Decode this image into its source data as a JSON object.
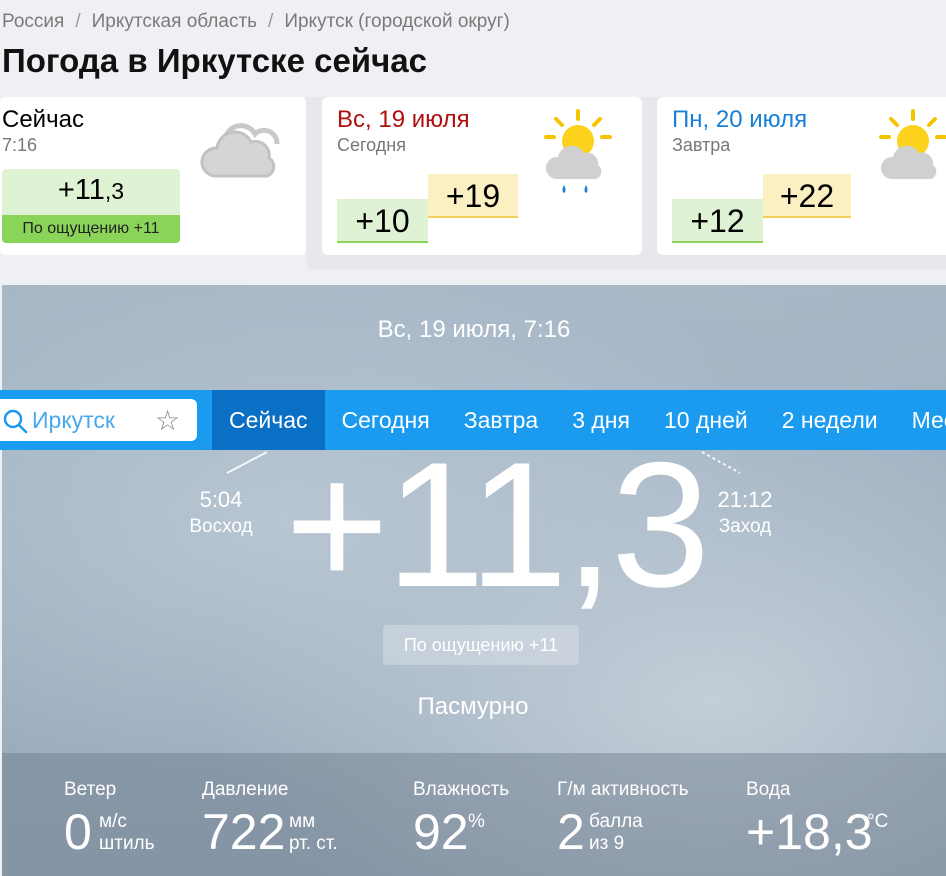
{
  "breadcrumb": [
    "Россия",
    "Иркутская область",
    "Иркутск (городской округ)"
  ],
  "page_title": "Погода в Иркутске сейчас",
  "now_card": {
    "title": "Сейчас",
    "time": "7:16",
    "temp_main": "+11",
    "temp_frac": ",3",
    "feels": "По ощущению +11",
    "icon": "cloudy-icon"
  },
  "today_card": {
    "title": "Вс, 19 июля",
    "sub": "Сегодня",
    "low": "+10",
    "high": "+19",
    "icon": "partly-cloudy-rain-icon"
  },
  "tomorrow_card": {
    "title": "Пн, 20 июля",
    "sub": "Завтра",
    "low": "+12",
    "high": "+22",
    "icon": "partly-cloudy-icon"
  },
  "hero": {
    "datetime": "Вс, 19 июля, 7:16",
    "temp": "+11,3",
    "feels": "По ощущению +11",
    "condition": "Пасмурно",
    "sunrise_time": "5:04",
    "sunrise_label": "Восход",
    "sunset_time": "21:12",
    "sunset_label": "Заход"
  },
  "search": {
    "value": "",
    "placeholder": "Иркутск"
  },
  "tabs": [
    "Сейчас",
    "Сегодня",
    "Завтра",
    "3 дня",
    "10 дней",
    "2 недели",
    "Месяц"
  ],
  "stats": {
    "wind": {
      "label": "Ветер",
      "value": "0",
      "unit": "м/с",
      "desc": "штиль"
    },
    "pressure": {
      "label": "Давление",
      "value": "722",
      "unit": "мм",
      "desc": "рт. ст."
    },
    "humidity": {
      "label": "Влажность",
      "value": "92",
      "unit": "%"
    },
    "geomagnetic": {
      "label": "Г/м активность",
      "value": "2",
      "unit": "балла",
      "desc": "из 9"
    },
    "water": {
      "label": "Вода",
      "value": "+18,3",
      "unit": "°C"
    }
  },
  "colors": {
    "nav": "#1b9bf0",
    "tab_active": "#0a70c6",
    "today_red": "#b10f0f",
    "tomorrow_blue": "#1a7fd6",
    "feels_green": "#8bd45a"
  }
}
